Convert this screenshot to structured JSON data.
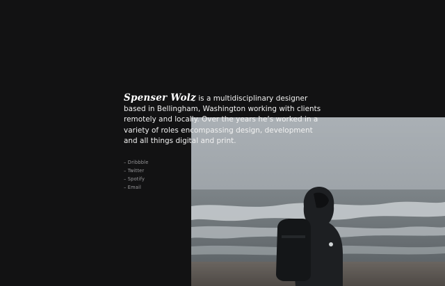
{
  "bio": {
    "name": "Spenser Wolz",
    "text": "is a multidisciplinary designer based in Bellingham, Washington working with clients remotely and locally. Over the years he’s worked in a variety of roles encompassing design, development and all things digital and print."
  },
  "links": [
    {
      "label": "Dribbble"
    },
    {
      "label": "Twitter"
    },
    {
      "label": "Spotify"
    },
    {
      "label": "Email"
    }
  ],
  "link_prefix": "–",
  "colors": {
    "background": "#121213",
    "text": "#f2f2f2",
    "link": "#9a9a9d",
    "sky": "#9aa0a6",
    "sea": "#6b7276",
    "sand": "#5a544e"
  },
  "photo": {
    "subject": "person-in-hooded-jacket-with-backpack-on-beach"
  }
}
